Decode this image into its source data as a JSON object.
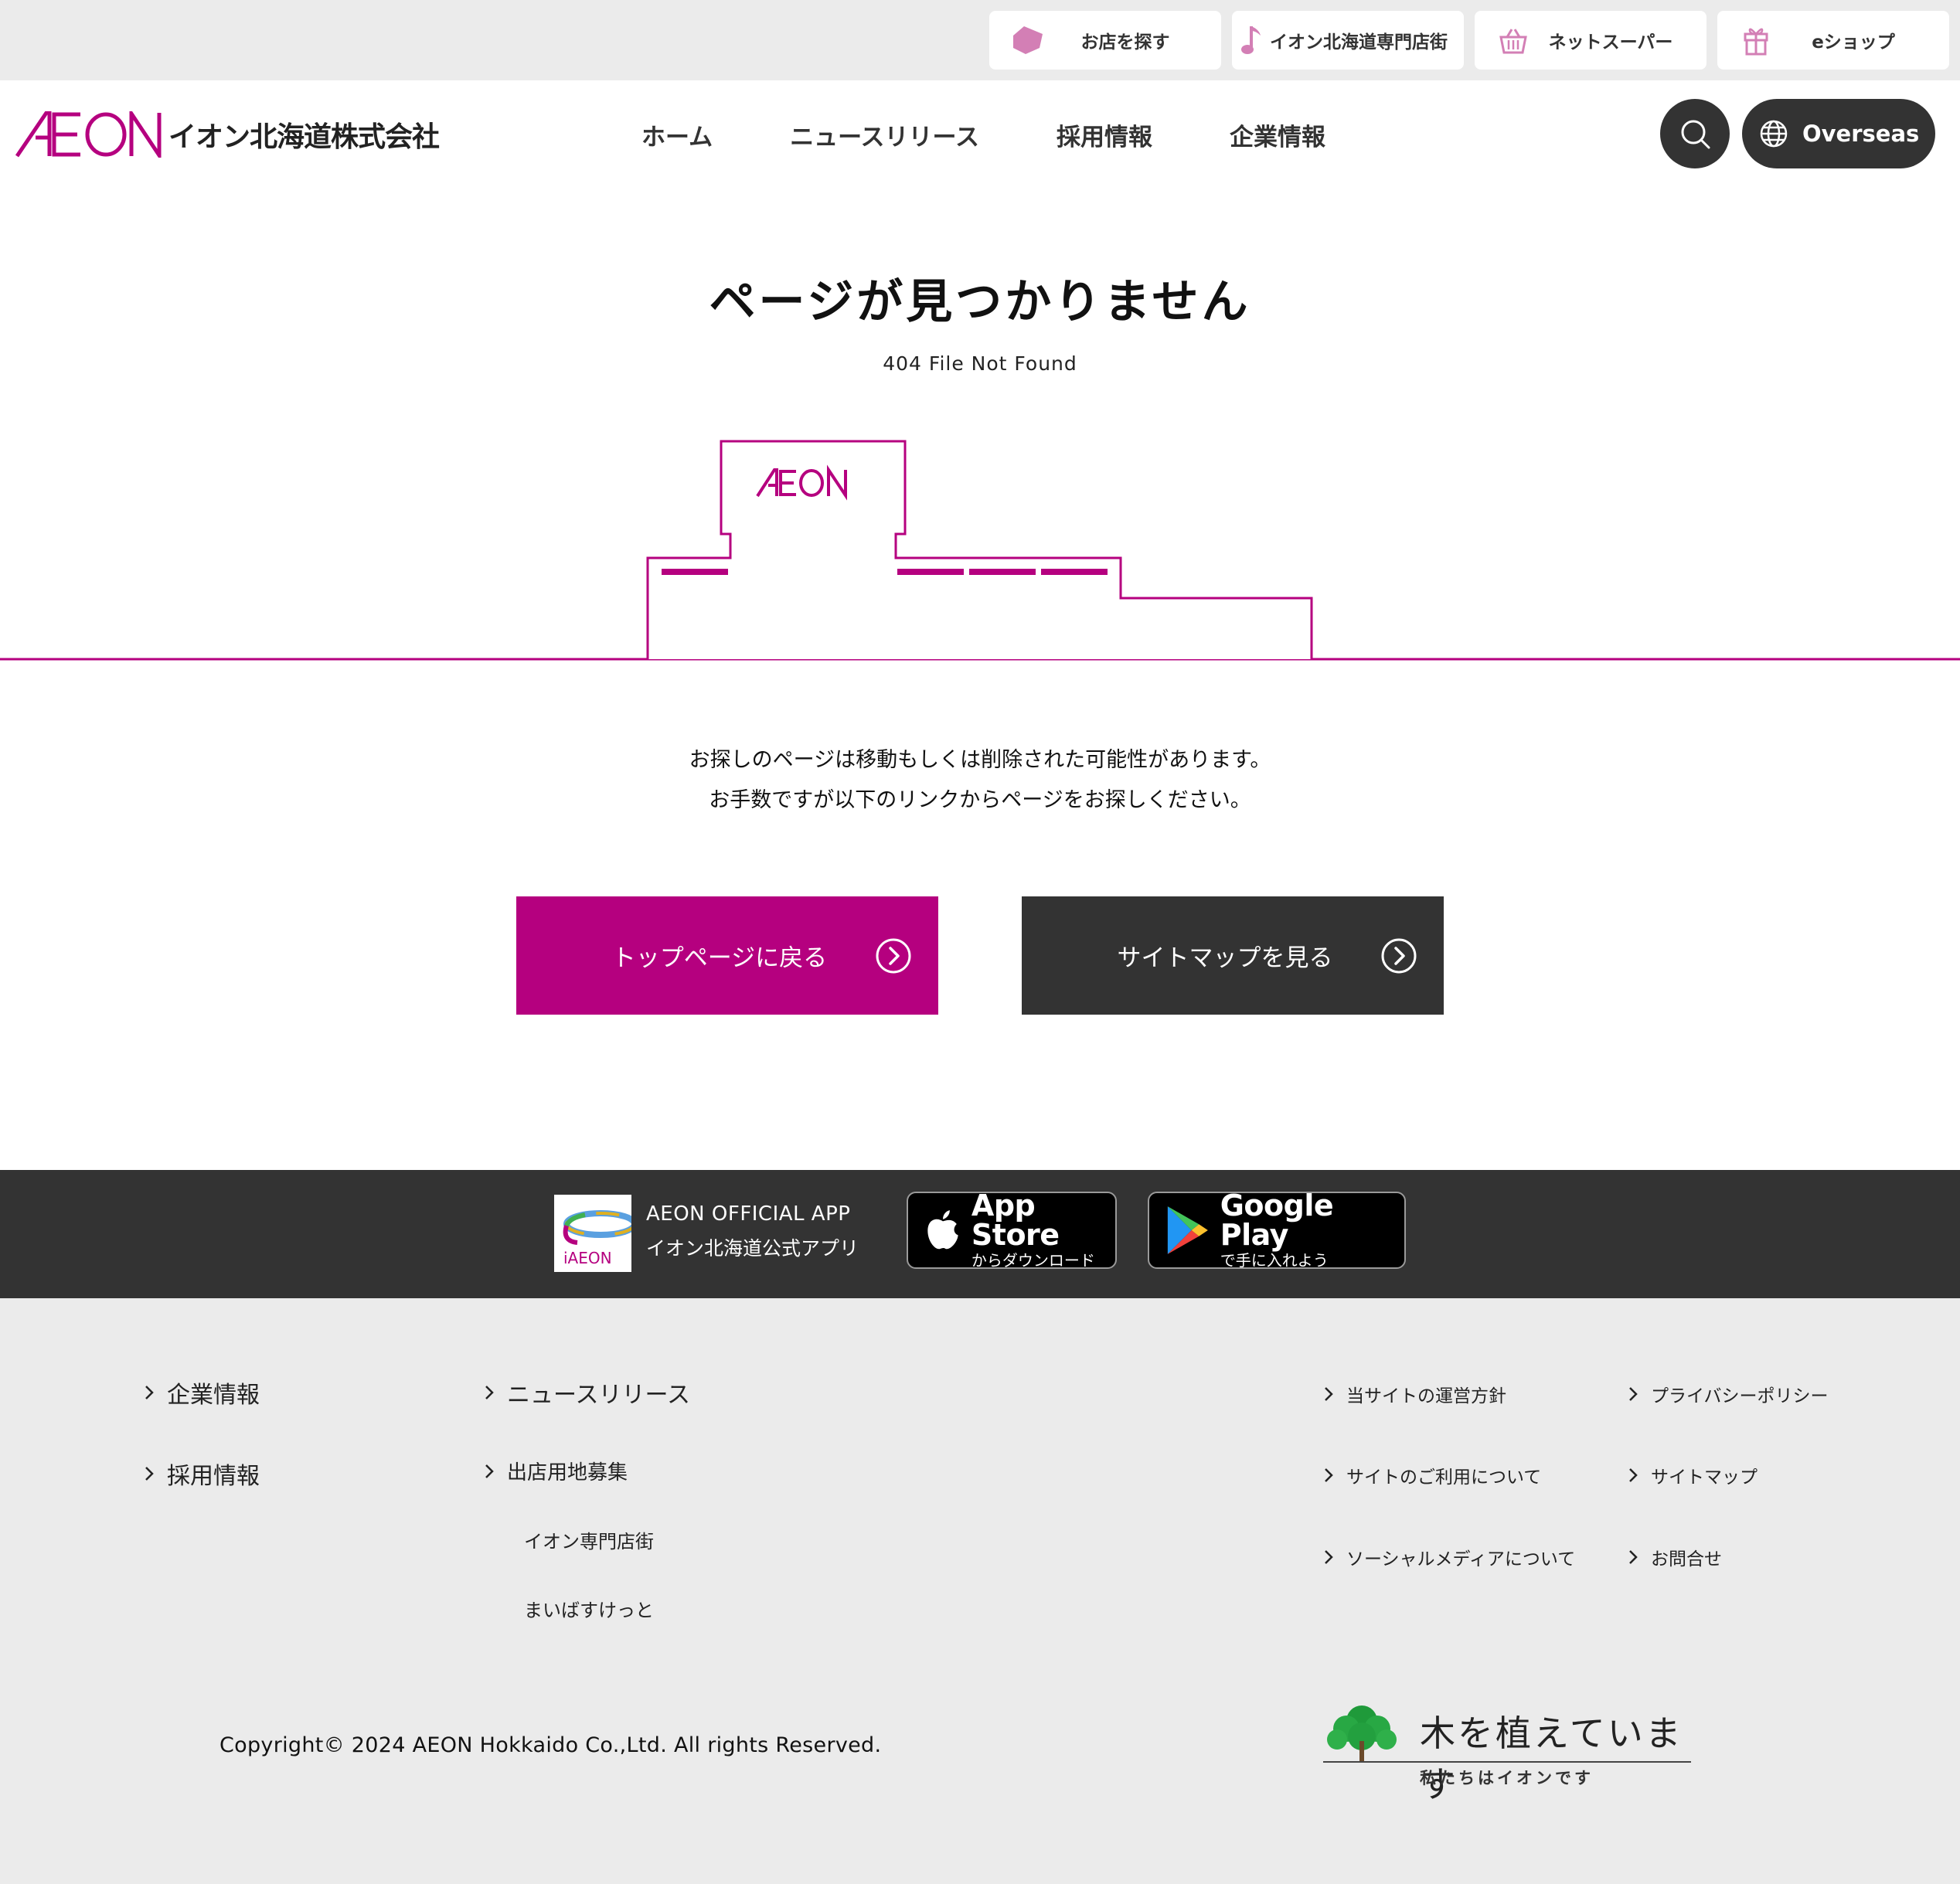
{
  "colors": {
    "brand": "#b5007f",
    "dark": "#333333",
    "utility_bg": "#ebebeb",
    "util_icon": "#d37fb5"
  },
  "utility": {
    "items": [
      {
        "icon": "tag-icon",
        "label": "お店を探す"
      },
      {
        "icon": "music-note-icon",
        "label": "イオン北海道専門店街"
      },
      {
        "icon": "basket-icon",
        "label": "ネットスーパー"
      },
      {
        "icon": "gift-icon",
        "label": "eショップ"
      }
    ]
  },
  "header": {
    "logo_mark": "ÆON",
    "logo_corp": "イオン北海道株式会社",
    "nav": [
      "ホーム",
      "ニュースリリース",
      "採用情報",
      "企業情報"
    ],
    "search_icon": "search-icon",
    "overseas_label": "Overseas"
  },
  "error": {
    "title": "ページが見つかりません",
    "subtitle": "404 File Not Found",
    "illustration_logo": "ÆON",
    "message_line1": "お探しのページは移動もしくは削除された可能性があります。",
    "message_line2": "お手数ですが以下のリンクからページをお探しください。",
    "btn_top": "トップページに戻る",
    "btn_sitemap": "サイトマップを見る"
  },
  "app": {
    "icon_text": "iAEON",
    "title": "AEON OFFICIAL APP",
    "subtitle": "イオン北海道公式アプリ",
    "appstore_big": "App Store",
    "appstore_small": "からダウンロード",
    "gplay_big": "Google Play",
    "gplay_small": "で手に入れよう"
  },
  "footer": {
    "col1": [
      "企業情報",
      "採用情報"
    ],
    "col2": [
      "ニュースリリース",
      "出店用地募集"
    ],
    "col2_sub": [
      "イオン専門店街",
      "まいばすけっと"
    ],
    "col3": [
      "当サイトの運営方針",
      "サイトのご利用について",
      "ソーシャルメディアについて"
    ],
    "col4": [
      "プライバシーポリシー",
      "サイトマップ",
      "お問合せ"
    ],
    "copyright": "Copyright© 2024 AEON Hokkaido Co.,Ltd. All rights Reserved.",
    "tree_main": "木を植えています",
    "tree_sub": "私たちはイオンです"
  }
}
